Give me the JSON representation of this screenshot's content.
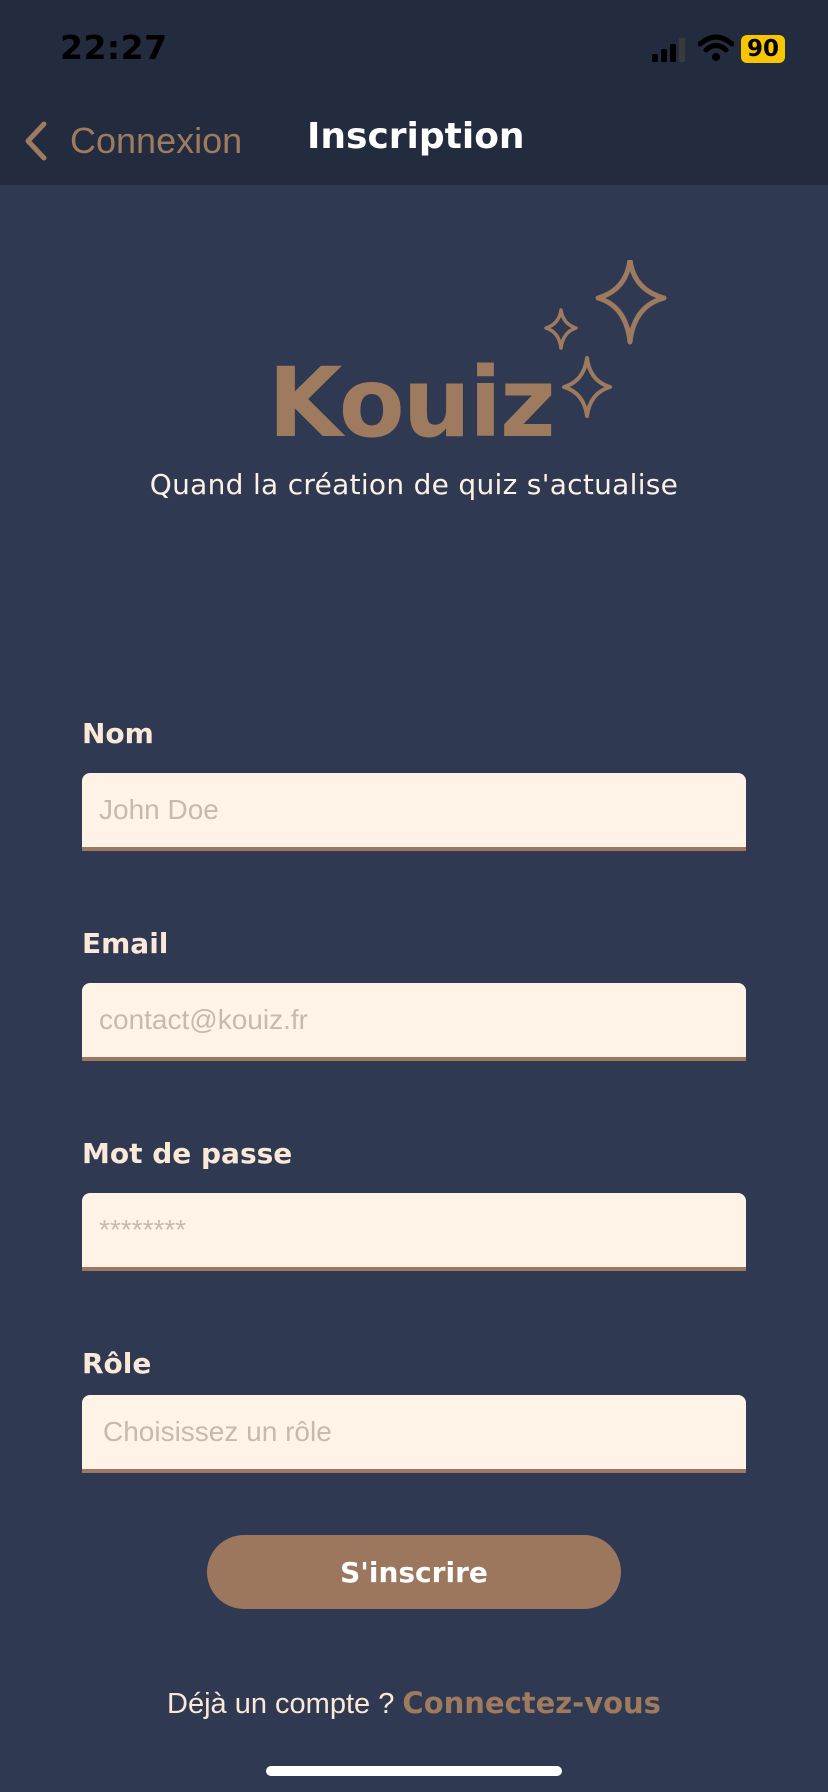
{
  "status_bar": {
    "time": "22:27",
    "battery": "90"
  },
  "nav": {
    "back_label": "Connexion",
    "title": "Inscription"
  },
  "branding": {
    "logo_text": "Kouiz",
    "tagline": "Quand la création de quiz s'actualise",
    "accent_color": "#9e7a5f"
  },
  "form": {
    "name": {
      "label": "Nom",
      "placeholder": "John Doe",
      "value": ""
    },
    "email": {
      "label": "Email",
      "placeholder": "contact@kouiz.fr",
      "value": ""
    },
    "password": {
      "label": "Mot de passe",
      "placeholder": "********",
      "value": ""
    },
    "role": {
      "label": "Rôle",
      "placeholder": "Choisissez un rôle"
    },
    "submit_label": "S'inscrire"
  },
  "footer": {
    "prompt": "Déjà un compte ?",
    "link": "Connectez-vous"
  },
  "colors": {
    "background": "#2f3a52",
    "header": "#232b3e",
    "input_bg": "#fff3e7",
    "button": "#9c775e",
    "battery": "#f7c600"
  }
}
